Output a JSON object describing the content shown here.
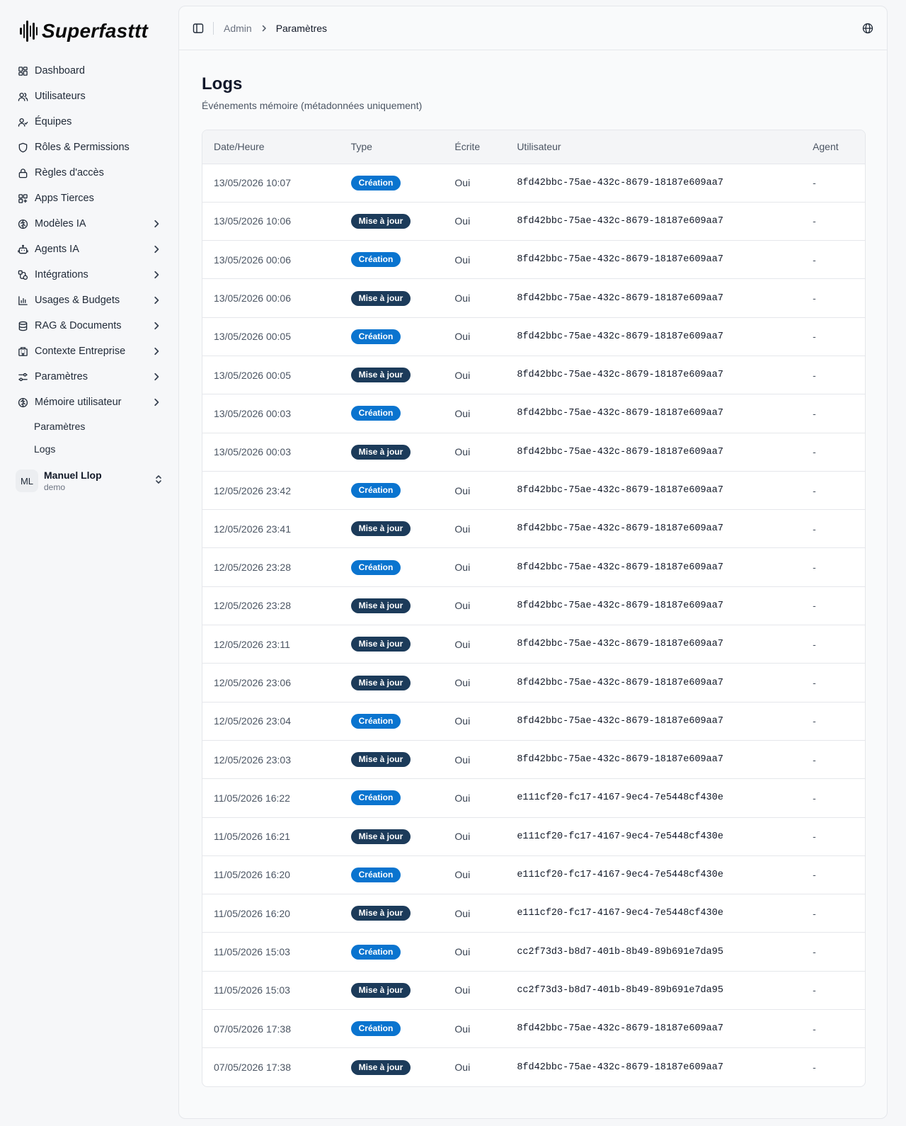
{
  "brand": {
    "name": "Superfasttt"
  },
  "sidebar": {
    "items": [
      {
        "label": "Dashboard",
        "icon": "dashboard-icon",
        "expandable": false
      },
      {
        "label": "Utilisateurs",
        "icon": "users-icon",
        "expandable": false
      },
      {
        "label": "Équipes",
        "icon": "team-icon",
        "expandable": false
      },
      {
        "label": "Rôles & Permissions",
        "icon": "shield-icon",
        "expandable": false
      },
      {
        "label": "Règles d'accès",
        "icon": "lock-icon",
        "expandable": false
      },
      {
        "label": "Apps Tierces",
        "icon": "apps-icon",
        "expandable": false
      },
      {
        "label": "Modèles IA",
        "icon": "brain-icon",
        "expandable": true
      },
      {
        "label": "Agents IA",
        "icon": "bot-icon",
        "expandable": true
      },
      {
        "label": "Intégrations",
        "icon": "integration-icon",
        "expandable": true
      },
      {
        "label": "Usages & Budgets",
        "icon": "chart-icon",
        "expandable": true
      },
      {
        "label": "RAG & Documents",
        "icon": "database-icon",
        "expandable": true
      },
      {
        "label": "Contexte Entreprise",
        "icon": "building-icon",
        "expandable": true
      },
      {
        "label": "Paramètres",
        "icon": "settings-icon",
        "expandable": true
      },
      {
        "label": "Mémoire utilisateur",
        "icon": "brain-icon",
        "expandable": true
      }
    ],
    "subitems": [
      {
        "label": "Paramètres"
      },
      {
        "label": "Logs"
      }
    ],
    "user": {
      "initials": "ML",
      "name": "Manuel Llop",
      "role": "demo"
    }
  },
  "topbar": {
    "breadcrumb": [
      "Admin",
      "Paramètres"
    ]
  },
  "page": {
    "title": "Logs",
    "subtitle": "Événements mémoire (métadonnées uniquement)"
  },
  "table": {
    "columns": [
      "Date/Heure",
      "Type",
      "Écrite",
      "Utilisateur",
      "Agent"
    ],
    "badge_colors": {
      "create": "#0a74cf",
      "update": "#1c3b5a"
    },
    "rows": [
      {
        "date": "13/05/2026 10:07",
        "type": "Création",
        "kind": "create",
        "written": "Oui",
        "user": "8fd42bbc-75ae-432c-8679-18187e609aa7",
        "agent": "-"
      },
      {
        "date": "13/05/2026 10:06",
        "type": "Mise à jour",
        "kind": "update",
        "written": "Oui",
        "user": "8fd42bbc-75ae-432c-8679-18187e609aa7",
        "agent": "-"
      },
      {
        "date": "13/05/2026 00:06",
        "type": "Création",
        "kind": "create",
        "written": "Oui",
        "user": "8fd42bbc-75ae-432c-8679-18187e609aa7",
        "agent": "-"
      },
      {
        "date": "13/05/2026 00:06",
        "type": "Mise à jour",
        "kind": "update",
        "written": "Oui",
        "user": "8fd42bbc-75ae-432c-8679-18187e609aa7",
        "agent": "-"
      },
      {
        "date": "13/05/2026 00:05",
        "type": "Création",
        "kind": "create",
        "written": "Oui",
        "user": "8fd42bbc-75ae-432c-8679-18187e609aa7",
        "agent": "-"
      },
      {
        "date": "13/05/2026 00:05",
        "type": "Mise à jour",
        "kind": "update",
        "written": "Oui",
        "user": "8fd42bbc-75ae-432c-8679-18187e609aa7",
        "agent": "-"
      },
      {
        "date": "13/05/2026 00:03",
        "type": "Création",
        "kind": "create",
        "written": "Oui",
        "user": "8fd42bbc-75ae-432c-8679-18187e609aa7",
        "agent": "-"
      },
      {
        "date": "13/05/2026 00:03",
        "type": "Mise à jour",
        "kind": "update",
        "written": "Oui",
        "user": "8fd42bbc-75ae-432c-8679-18187e609aa7",
        "agent": "-"
      },
      {
        "date": "12/05/2026 23:42",
        "type": "Création",
        "kind": "create",
        "written": "Oui",
        "user": "8fd42bbc-75ae-432c-8679-18187e609aa7",
        "agent": "-"
      },
      {
        "date": "12/05/2026 23:41",
        "type": "Mise à jour",
        "kind": "update",
        "written": "Oui",
        "user": "8fd42bbc-75ae-432c-8679-18187e609aa7",
        "agent": "-"
      },
      {
        "date": "12/05/2026 23:28",
        "type": "Création",
        "kind": "create",
        "written": "Oui",
        "user": "8fd42bbc-75ae-432c-8679-18187e609aa7",
        "agent": "-"
      },
      {
        "date": "12/05/2026 23:28",
        "type": "Mise à jour",
        "kind": "update",
        "written": "Oui",
        "user": "8fd42bbc-75ae-432c-8679-18187e609aa7",
        "agent": "-"
      },
      {
        "date": "12/05/2026 23:11",
        "type": "Mise à jour",
        "kind": "update",
        "written": "Oui",
        "user": "8fd42bbc-75ae-432c-8679-18187e609aa7",
        "agent": "-"
      },
      {
        "date": "12/05/2026 23:06",
        "type": "Mise à jour",
        "kind": "update",
        "written": "Oui",
        "user": "8fd42bbc-75ae-432c-8679-18187e609aa7",
        "agent": "-"
      },
      {
        "date": "12/05/2026 23:04",
        "type": "Création",
        "kind": "create",
        "written": "Oui",
        "user": "8fd42bbc-75ae-432c-8679-18187e609aa7",
        "agent": "-"
      },
      {
        "date": "12/05/2026 23:03",
        "type": "Mise à jour",
        "kind": "update",
        "written": "Oui",
        "user": "8fd42bbc-75ae-432c-8679-18187e609aa7",
        "agent": "-"
      },
      {
        "date": "11/05/2026 16:22",
        "type": "Création",
        "kind": "create",
        "written": "Oui",
        "user": "e111cf20-fc17-4167-9ec4-7e5448cf430e",
        "agent": "-"
      },
      {
        "date": "11/05/2026 16:21",
        "type": "Mise à jour",
        "kind": "update",
        "written": "Oui",
        "user": "e111cf20-fc17-4167-9ec4-7e5448cf430e",
        "agent": "-"
      },
      {
        "date": "11/05/2026 16:20",
        "type": "Création",
        "kind": "create",
        "written": "Oui",
        "user": "e111cf20-fc17-4167-9ec4-7e5448cf430e",
        "agent": "-"
      },
      {
        "date": "11/05/2026 16:20",
        "type": "Mise à jour",
        "kind": "update",
        "written": "Oui",
        "user": "e111cf20-fc17-4167-9ec4-7e5448cf430e",
        "agent": "-"
      },
      {
        "date": "11/05/2026 15:03",
        "type": "Création",
        "kind": "create",
        "written": "Oui",
        "user": "cc2f73d3-b8d7-401b-8b49-89b691e7da95",
        "agent": "-"
      },
      {
        "date": "11/05/2026 15:03",
        "type": "Mise à jour",
        "kind": "update",
        "written": "Oui",
        "user": "cc2f73d3-b8d7-401b-8b49-89b691e7da95",
        "agent": "-"
      },
      {
        "date": "07/05/2026 17:38",
        "type": "Création",
        "kind": "create",
        "written": "Oui",
        "user": "8fd42bbc-75ae-432c-8679-18187e609aa7",
        "agent": "-"
      },
      {
        "date": "07/05/2026 17:38",
        "type": "Mise à jour",
        "kind": "update",
        "written": "Oui",
        "user": "8fd42bbc-75ae-432c-8679-18187e609aa7",
        "agent": "-"
      }
    ]
  }
}
